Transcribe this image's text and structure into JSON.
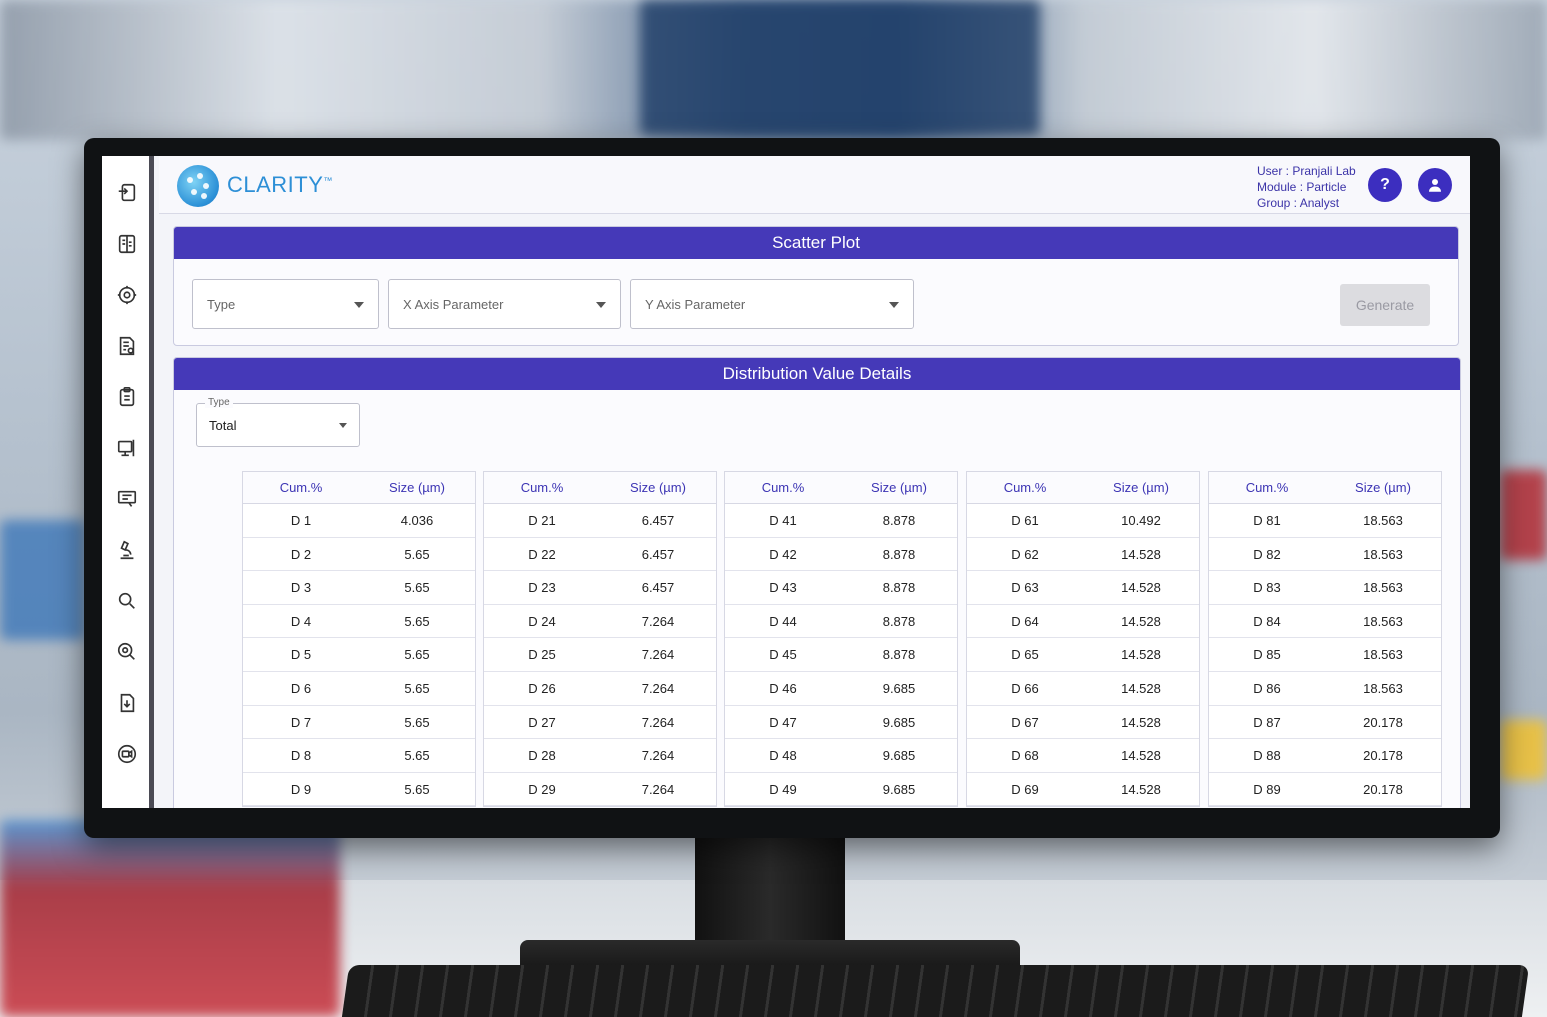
{
  "brand": {
    "name": "CLARITY",
    "trademark": "™"
  },
  "user": {
    "user_line": "User : Pranjali Lab",
    "module_line": "Module : Particle",
    "group_line": "Group : Analyst"
  },
  "header_buttons": {
    "help": "?"
  },
  "rail_icons": [
    "import-icon",
    "report-icon",
    "settings-icon",
    "document-search-icon",
    "clipboard-icon",
    "monitor-icon",
    "comment-icon",
    "microscope-icon",
    "search-icon",
    "search-settings-icon",
    "download-icon",
    "video-icon"
  ],
  "scatter": {
    "title": "Scatter Plot",
    "type_placeholder": "Type",
    "x_placeholder": "X Axis Parameter",
    "y_placeholder": "Y Axis Parameter",
    "generate_label": "Generate"
  },
  "distribution": {
    "title": "Distribution Value Details",
    "type_label": "Type",
    "type_value": "Total",
    "col_cum": "Cum.%",
    "col_size": "Size (µm)",
    "tables": [
      {
        "rows": [
          [
            "D 1",
            "4.036"
          ],
          [
            "D 2",
            "5.65"
          ],
          [
            "D 3",
            "5.65"
          ],
          [
            "D 4",
            "5.65"
          ],
          [
            "D 5",
            "5.65"
          ],
          [
            "D 6",
            "5.65"
          ],
          [
            "D 7",
            "5.65"
          ],
          [
            "D 8",
            "5.65"
          ],
          [
            "D 9",
            "5.65"
          ]
        ]
      },
      {
        "rows": [
          [
            "D 21",
            "6.457"
          ],
          [
            "D 22",
            "6.457"
          ],
          [
            "D 23",
            "6.457"
          ],
          [
            "D 24",
            "7.264"
          ],
          [
            "D 25",
            "7.264"
          ],
          [
            "D 26",
            "7.264"
          ],
          [
            "D 27",
            "7.264"
          ],
          [
            "D 28",
            "7.264"
          ],
          [
            "D 29",
            "7.264"
          ]
        ]
      },
      {
        "rows": [
          [
            "D 41",
            "8.878"
          ],
          [
            "D 42",
            "8.878"
          ],
          [
            "D 43",
            "8.878"
          ],
          [
            "D 44",
            "8.878"
          ],
          [
            "D 45",
            "8.878"
          ],
          [
            "D 46",
            "9.685"
          ],
          [
            "D 47",
            "9.685"
          ],
          [
            "D 48",
            "9.685"
          ],
          [
            "D 49",
            "9.685"
          ]
        ]
      },
      {
        "rows": [
          [
            "D 61",
            "10.492"
          ],
          [
            "D 62",
            "14.528"
          ],
          [
            "D 63",
            "14.528"
          ],
          [
            "D 64",
            "14.528"
          ],
          [
            "D 65",
            "14.528"
          ],
          [
            "D 66",
            "14.528"
          ],
          [
            "D 67",
            "14.528"
          ],
          [
            "D 68",
            "14.528"
          ],
          [
            "D 69",
            "14.528"
          ]
        ]
      },
      {
        "rows": [
          [
            "D 81",
            "18.563"
          ],
          [
            "D 82",
            "18.563"
          ],
          [
            "D 83",
            "18.563"
          ],
          [
            "D 84",
            "18.563"
          ],
          [
            "D 85",
            "18.563"
          ],
          [
            "D 86",
            "18.563"
          ],
          [
            "D 87",
            "20.178"
          ],
          [
            "D 88",
            "20.178"
          ],
          [
            "D 89",
            "20.178"
          ]
        ]
      }
    ]
  },
  "colors": {
    "accent": "#4539b8",
    "brand": "#2d8fd6",
    "header_text": "#3c34b4"
  }
}
